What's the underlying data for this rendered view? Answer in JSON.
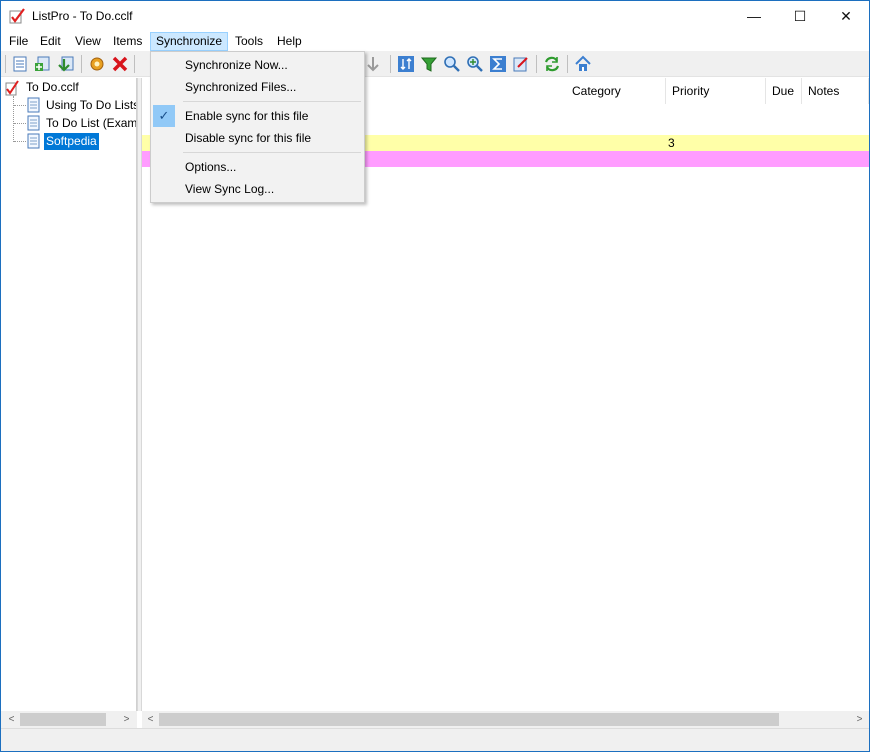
{
  "window": {
    "title": "ListPro - To Do.cclf",
    "minimize": "—",
    "maximize": "☐",
    "close": "✕"
  },
  "menubar": {
    "items": [
      "File",
      "Edit",
      "View",
      "Items",
      "Synchronize",
      "Tools",
      "Help"
    ],
    "active": "Synchronize"
  },
  "toolbar": {
    "icons": [
      "new-list-icon",
      "add-item-icon",
      "import-icon",
      "settings-icon",
      "delete-icon",
      "sort-icon",
      "filter-icon",
      "find-icon",
      "zoom-icon",
      "sum-icon",
      "edit-icon",
      "sync-icon",
      "home-icon",
      "arrow-down-icon"
    ]
  },
  "tree": {
    "root": "To Do.cclf",
    "children": [
      "Using To Do Lists",
      "To Do List (Example)",
      "Softpedia"
    ],
    "selected": "Softpedia"
  },
  "list": {
    "columns": [
      "Category",
      "Priority",
      "Due",
      "Notes"
    ],
    "rows": [
      {
        "color": "#ffffa8",
        "priority": "3"
      },
      {
        "color": "#ff9cff",
        "priority": ""
      }
    ]
  },
  "dropdown": {
    "items": [
      {
        "label": "Synchronize Now...",
        "checked": false
      },
      {
        "label": "Synchronized Files...",
        "checked": false
      },
      {
        "label": "Enable sync for this file",
        "checked": true
      },
      {
        "label": "Disable sync for this file",
        "checked": false
      },
      {
        "label": "Options...",
        "checked": false
      },
      {
        "label": "View Sync Log...",
        "checked": false
      }
    ],
    "check_glyph": "✓"
  },
  "scroll": {
    "left_arrow": "<",
    "right_arrow": ">"
  }
}
